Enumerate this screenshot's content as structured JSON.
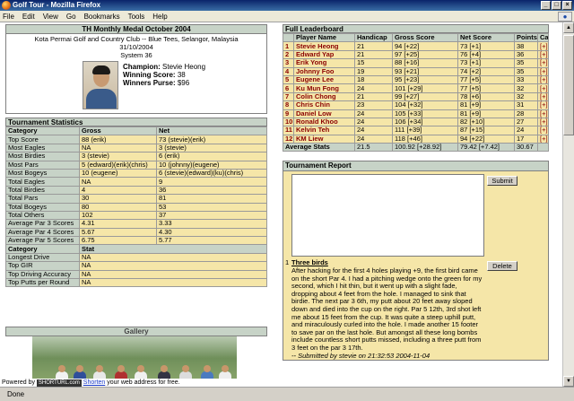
{
  "window": {
    "title": "Golf Tour - Mozilla Firefox",
    "min": "_",
    "max": "□",
    "close": "×"
  },
  "menu": [
    "File",
    "Edit",
    "View",
    "Go",
    "Bookmarks",
    "Tools",
    "Help"
  ],
  "competition": {
    "title": "TH Monthly Medal October 2004",
    "venue": "Kota Permai Golf and Country Club -- Blue Tees, Selangor, Malaysia",
    "date": "31/10/2004",
    "system": "System 36",
    "champion_label": "Champion:",
    "champion": "Stevie Heong",
    "winning_label": "Winning Score:",
    "winning_score": "38",
    "purse_label": "Winners Purse:",
    "purse": "$96"
  },
  "stats": {
    "title": "Tournament Statistics",
    "headers": [
      "Category",
      "Gross",
      "Net"
    ],
    "rows": [
      [
        "Top Score",
        "88 (erik)",
        "73 (stevie)(erik)"
      ],
      [
        "Most Eagles",
        "NA",
        "3 (stevie)"
      ],
      [
        "Most Birdies",
        "3 (stevie)",
        "6 (erik)"
      ],
      [
        "Most Pars",
        "5 (edward)(erik)(chris)",
        "10 (johnny)(eugene)"
      ],
      [
        "Most Bogeys",
        "10 (eugene)",
        "6 (stevie)(edward)(ku)(chris)"
      ],
      [
        "Total Eagles",
        "NA",
        "9"
      ],
      [
        "Total Birdies",
        "4",
        "36"
      ],
      [
        "Total Pars",
        "30",
        "81"
      ],
      [
        "Total Bogeys",
        "80",
        "53"
      ],
      [
        "Total Others",
        "102",
        "37"
      ],
      [
        "Average Par 3 Scores",
        "4.31",
        "3.33"
      ],
      [
        "Average Par 4 Scores",
        "5.67",
        "4.30"
      ],
      [
        "Average Par 5 Scores",
        "6.75",
        "5.77"
      ]
    ],
    "headers2": [
      "Category",
      "Stat"
    ],
    "rows2": [
      [
        "Longest Drive",
        "NA"
      ],
      [
        "Top GIR",
        "NA"
      ],
      [
        "Top Driving Accuracy",
        "NA"
      ],
      [
        "Top Putts per Round",
        "NA"
      ]
    ]
  },
  "gallery": {
    "title": "Gallery"
  },
  "leaderboard": {
    "title": "Full Leaderboard",
    "headers": [
      "",
      "Player Name",
      "Handicap",
      "Gross Score",
      "Net Score",
      "Points",
      "Card"
    ],
    "rows": [
      [
        "1",
        "Stevie Heong",
        "21",
        "94 [+22]",
        "73 [+1]",
        "38",
        "[+]"
      ],
      [
        "2",
        "Edward Yap",
        "21",
        "97 [+25]",
        "76 [+4]",
        "36",
        "[+]"
      ],
      [
        "3",
        "Erik Yong",
        "15",
        "88 [+16]",
        "73 [+1]",
        "35",
        "[+]"
      ],
      [
        "4",
        "Johnny Foo",
        "19",
        "93 [+21]",
        "74 [+2]",
        "35",
        "[+]"
      ],
      [
        "5",
        "Eugene Lee",
        "18",
        "95 [+23]",
        "77 [+5]",
        "33",
        "[+]"
      ],
      [
        "6",
        "Ku Mun Fong",
        "24",
        "101 [+29]",
        "77 [+5]",
        "32",
        "[+]"
      ],
      [
        "7",
        "Colin Chong",
        "21",
        "99 [+27]",
        "78 [+6]",
        "32",
        "[+]"
      ],
      [
        "8",
        "Chris Chin",
        "23",
        "104 [+32]",
        "81 [+9]",
        "31",
        "[+]"
      ],
      [
        "9",
        "Daniel Low",
        "24",
        "105 [+33]",
        "81 [+9]",
        "28",
        "[+]"
      ],
      [
        "10",
        "Ronald Khoo",
        "24",
        "106 [+34]",
        "82 [+10]",
        "27",
        "[+]"
      ],
      [
        "11",
        "Kelvin Teh",
        "24",
        "111 [+39]",
        "87 [+15]",
        "24",
        "[+]"
      ],
      [
        "12",
        "KM Liew",
        "24",
        "118 [+46]",
        "94 [+22]",
        "17",
        "[+]"
      ]
    ],
    "average": [
      "Average Stats",
      "21.5",
      "100.92 [+28.92]",
      "79.42 [+7.42]",
      "30.67",
      ""
    ]
  },
  "report": {
    "title": "Tournament Report",
    "submit": "Submit",
    "delete": "Delete",
    "post_num": "1",
    "post_title": "Three birds",
    "post_body": "After hacking for the first 4 holes playing +9, the first bird came on the short Par 4. I had a pitching wedge onto the green for my second, which I hit thin, but it went up with a slight fade, dropping about 4 feet from the hole. I managed to sink that birdie. The next par 3 6th, my putt about 20 feet away sloped down and died into the cup on the right. Par 5 12th, 3rd shot left me about 15 feet from the cup. It was quite a steep uphill putt, and miraculously curled into the hole. I made another 15 footer to save par on the last hole. But amongst all these long bombs include countless short putts missed, including a three putt from 3 feet on the par 3 17th.",
    "post_sub": "-- Submitted by stevie on 21:32:53 2004-11-04"
  },
  "powered": {
    "prefix": "Powered by",
    "badge": "SHORTURL.com",
    "link": "Shorten",
    "suffix": "your web address for free."
  },
  "status": {
    "text": "Done"
  }
}
